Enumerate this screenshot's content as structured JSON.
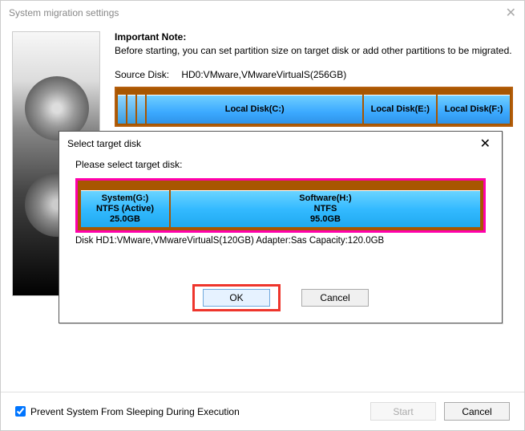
{
  "window": {
    "title": "System migration settings"
  },
  "note": {
    "heading": "Important Note:",
    "text": "Before starting, you can set partition size on target disk or add other partitions to be migrated."
  },
  "source": {
    "label": "Source Disk:",
    "value": "HD0:VMware,VMwareVirtualS(256GB)",
    "partitions": {
      "c": "Local Disk(C:)",
      "e": "Local Disk(E:)",
      "f": "Local Disk(F:)"
    }
  },
  "modal": {
    "title": "Select target disk",
    "prompt": "Please select target disk:",
    "partitions": {
      "g": {
        "line1": "System(G:)",
        "line2": "NTFS (Active)",
        "line3": "25.0GB"
      },
      "h": {
        "line1": "Software(H:)",
        "line2": "NTFS",
        "line3": "95.0GB"
      }
    },
    "info": "Disk HD1:VMware,VMwareVirtualS(120GB)  Adapter:Sas  Capacity:120.0GB",
    "buttons": {
      "ok": "OK",
      "cancel": "Cancel"
    }
  },
  "footer": {
    "checkbox_label": "Prevent System From Sleeping During Execution",
    "start": "Start",
    "cancel": "Cancel"
  }
}
